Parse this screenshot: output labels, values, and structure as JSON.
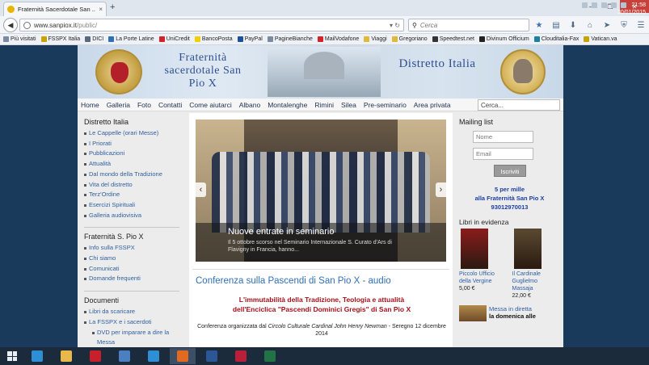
{
  "browser": {
    "tab_title": "Fraternità Sacerdotale San ...",
    "tab_close": "×",
    "new_tab": "+",
    "url_host": "www.sanpiox.it",
    "url_path": "/public/",
    "search_placeholder": "Cerca",
    "window_buttons": [
      "–",
      "❐",
      "✕"
    ],
    "bookmarks": [
      {
        "label": "Più visitati",
        "color": "#7a8aa0"
      },
      {
        "label": "FSSPX Italia",
        "color": "#c8a400"
      },
      {
        "label": "DICI",
        "color": "#5a6a7a"
      },
      {
        "label": "La Porte Latine",
        "color": "#2f6fb5"
      },
      {
        "label": "UniCredit",
        "color": "#d3222a"
      },
      {
        "label": "BancoPosta",
        "color": "#f2d000"
      },
      {
        "label": "PayPal",
        "color": "#1d4f9f"
      },
      {
        "label": "PagineBianche",
        "color": "#7a8aa0"
      },
      {
        "label": "MailVodafone",
        "color": "#d3222a"
      },
      {
        "label": "Viaggi",
        "color": "#e0b83a"
      },
      {
        "label": "Gregoriano",
        "color": "#e0b83a"
      },
      {
        "label": "Speedtest.net",
        "color": "#333333"
      },
      {
        "label": "Divinum Officium",
        "color": "#222222"
      },
      {
        "label": "Clouditalia-Fax",
        "color": "#1f7f9f"
      },
      {
        "label": "Vatican.va",
        "color": "#c8a400"
      }
    ]
  },
  "site": {
    "header_left": "Fraternità sacerdotale San Pio X",
    "header_right": "Distretto Italia",
    "menu": [
      "Home",
      "Galleria",
      "Foto",
      "Contatti",
      "Come aiutarci",
      "Albano",
      "Montalenghe",
      "Rimini",
      "Silea",
      "Pre-seminario",
      "Area privata"
    ],
    "search_value": "Cerca...",
    "left": {
      "distretto_title": "Distretto Italia",
      "distretto_items": [
        "Le Cappelle (orari Messe)",
        "I Priorati",
        "Pubblicazioni",
        "Attualità",
        "Dal mondo della Tradizione",
        "Vita del distretto",
        "Terz'Ordine",
        "Esercizi Spirituali",
        "Galleria audiovisiva"
      ],
      "fraternita_title": "Fraternità S. Pio X",
      "fraternita_items": [
        "Info sulla FSSPX",
        "Chi siamo",
        "Comunicati",
        "Domande frequenti"
      ],
      "documenti_title": "Documenti",
      "documenti_items": [
        "Libri da scaricare",
        "La FSSPX e i sacerdoti"
      ],
      "documenti_sub": "DVD per imparare a dire la Messa"
    },
    "slider": {
      "title": "Nuove entrate in seminario",
      "text": "Il 5 ottobre scorso nel Seminario Internazionale S. Curato d'Ars di Flavigny in Francia, hanno...",
      "prev": "‹",
      "next": "›"
    },
    "article": {
      "title": "Conferenza sulla Pascendi di San Pio X - audio",
      "subtitle_line1": "L'immutabilità della Tradizione, Teologia e attualità",
      "subtitle_line2": "dell'Enciclica \"Pascendi Dominici Gregis\" di San Pio X",
      "meta_prefix": "Conferenza organizzata dal ",
      "meta_org": "Circolo Culturale Cardinal John Henry Newman",
      "meta_suffix": " - Seregno 12 dicembre 2014"
    },
    "right": {
      "mailing_title": "Mailing list",
      "name_placeholder": "Nome",
      "email_placeholder": "Email",
      "subscribe": "Iscriviti",
      "permille_l1": "5 per mille",
      "permille_l2": "alla Fraternità San Pio X",
      "permille_l3": "93012970013",
      "books_title": "Libri in evidenza",
      "books": [
        {
          "title": "Piccolo Ufficio della Vergine",
          "title_lines": [
            "Piccolo Ufficio",
            "della Vergine"
          ],
          "price": "5,00 €",
          "color": "#8b1c1c"
        },
        {
          "title": "Il Cardinale Guglielmo Massaja",
          "title_lines": [
            "Il Cardinale",
            "Guglielmo",
            "Massaja"
          ],
          "price": "22,00 €",
          "color": "#5a4a32"
        }
      ],
      "mass_title": "Messa in diretta",
      "mass_sub": "la domenica alle"
    }
  },
  "taskbar": {
    "time": "21:58",
    "date": "30/01/2015",
    "apps": [
      {
        "name": "pin-app",
        "color": "#2f8fd5"
      },
      {
        "name": "file-explorer",
        "color": "#e8b84a"
      },
      {
        "name": "acrobat",
        "color": "#c8202a"
      },
      {
        "name": "thunderbird",
        "color": "#4a7fc2"
      },
      {
        "name": "internet-explorer",
        "color": "#2f8fd5"
      },
      {
        "name": "firefox",
        "color": "#e06a1f",
        "active": true
      },
      {
        "name": "word",
        "color": "#2b5797"
      },
      {
        "name": "acrobat-pro",
        "color": "#b8203a"
      },
      {
        "name": "excel",
        "color": "#217346"
      }
    ]
  }
}
